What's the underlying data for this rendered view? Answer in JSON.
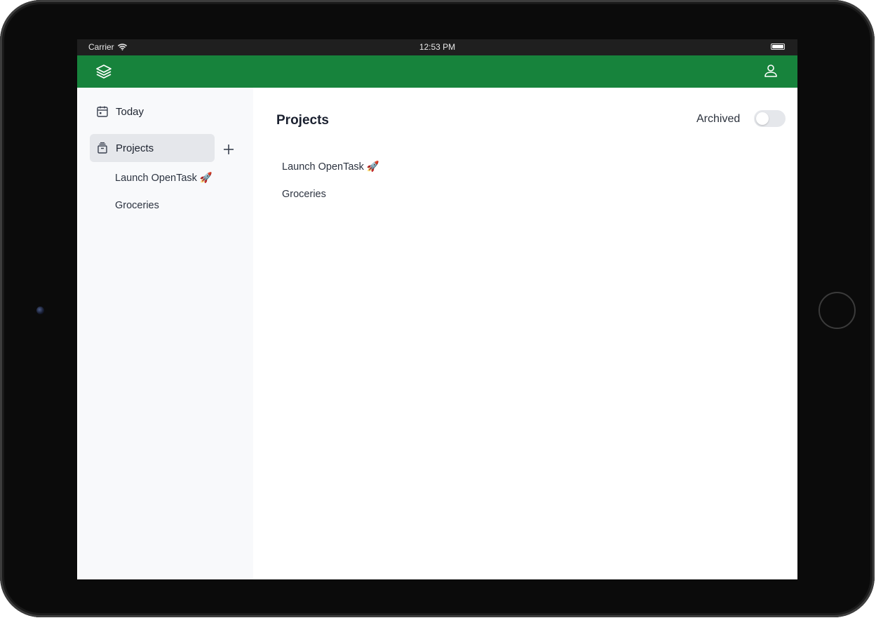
{
  "status_bar": {
    "carrier": "Carrier",
    "time": "12:53 PM"
  },
  "colors": {
    "accent": "#17833c",
    "sidebar_bg": "#f8f9fb",
    "active_bg": "#e5e7eb"
  },
  "header": {
    "logo_icon": "layers-icon",
    "profile_icon": "user-icon"
  },
  "sidebar": {
    "today_label": "Today",
    "projects_label": "Projects",
    "add_icon": "plus-icon",
    "projects": [
      "Launch OpenTask 🚀",
      "Groceries"
    ]
  },
  "main": {
    "title": "Projects",
    "archived_label": "Archived",
    "archived_toggle_on": false,
    "projects": [
      "Launch OpenTask 🚀",
      "Groceries"
    ]
  }
}
